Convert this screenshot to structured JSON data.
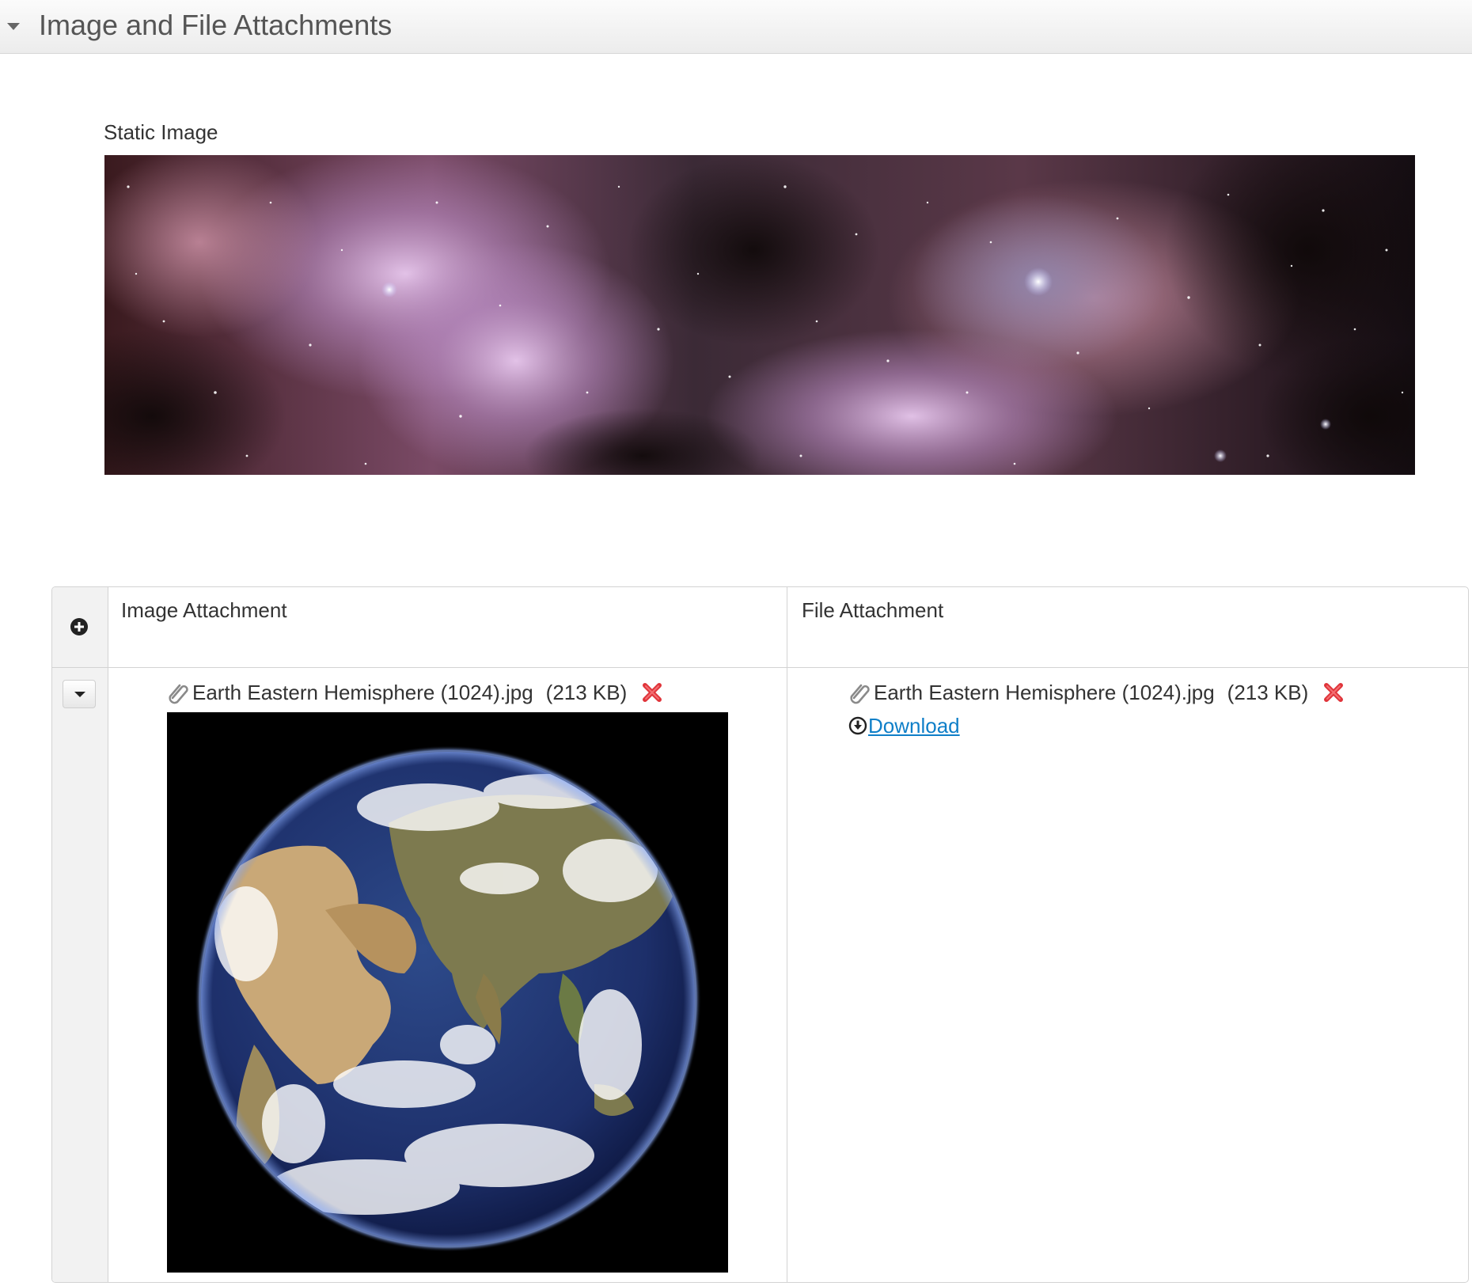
{
  "section": {
    "title": "Image and File Attachments",
    "collapse_icon": "caret-down-icon"
  },
  "static_image": {
    "label": "Static Image",
    "image": "nebula-photo"
  },
  "attachments_grid": {
    "add_icon": "plus-circle-icon",
    "row_menu_icon": "caret-down-icon",
    "columns": [
      {
        "header": "Image Attachment"
      },
      {
        "header": "File Attachment"
      }
    ],
    "rows": [
      {
        "image_attachment": {
          "icon": "paperclip-icon",
          "file_name": "Earth Eastern Hemisphere (1024).jpg",
          "file_size": "(213 KB)",
          "remove_icon": "red-x-icon",
          "preview": "earth-photo"
        },
        "file_attachment": {
          "icon": "paperclip-icon",
          "file_name": "Earth Eastern Hemisphere (1024).jpg",
          "file_size": "(213 KB)",
          "remove_icon": "red-x-icon",
          "download_icon": "download-circle-icon",
          "download_label": "Download"
        }
      }
    ]
  },
  "colors": {
    "link": "#0f7fc8",
    "remove": "#e0343a",
    "header_bg": "#f0f0f0",
    "gutter_bg": "#f2f2f2"
  }
}
